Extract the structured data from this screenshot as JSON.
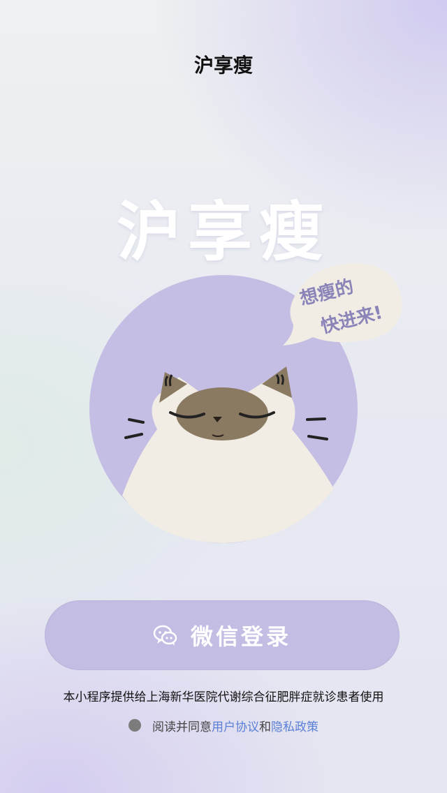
{
  "header": {
    "title": "沪享瘦"
  },
  "hero": {
    "logo_text": "沪享瘦",
    "bubble_line1": "想瘦的",
    "bubble_line2": "快进来!"
  },
  "login": {
    "button_label": "微信登录",
    "icon": "wechat-icon"
  },
  "notice": {
    "text": "本小程序提供给上海新华医院代谢综合征肥胖症就诊患者使用"
  },
  "agreement": {
    "prefix": "阅读并同意",
    "link_terms": "用户协议",
    "conjunction": "和",
    "link_privacy": "隐私政策",
    "checked": false
  },
  "colors": {
    "circle": "#c4bde4",
    "cat_body": "#f1ede4",
    "cat_mask": "#8a7a62",
    "button": "#c3bde3",
    "link": "#5b7fd6"
  }
}
